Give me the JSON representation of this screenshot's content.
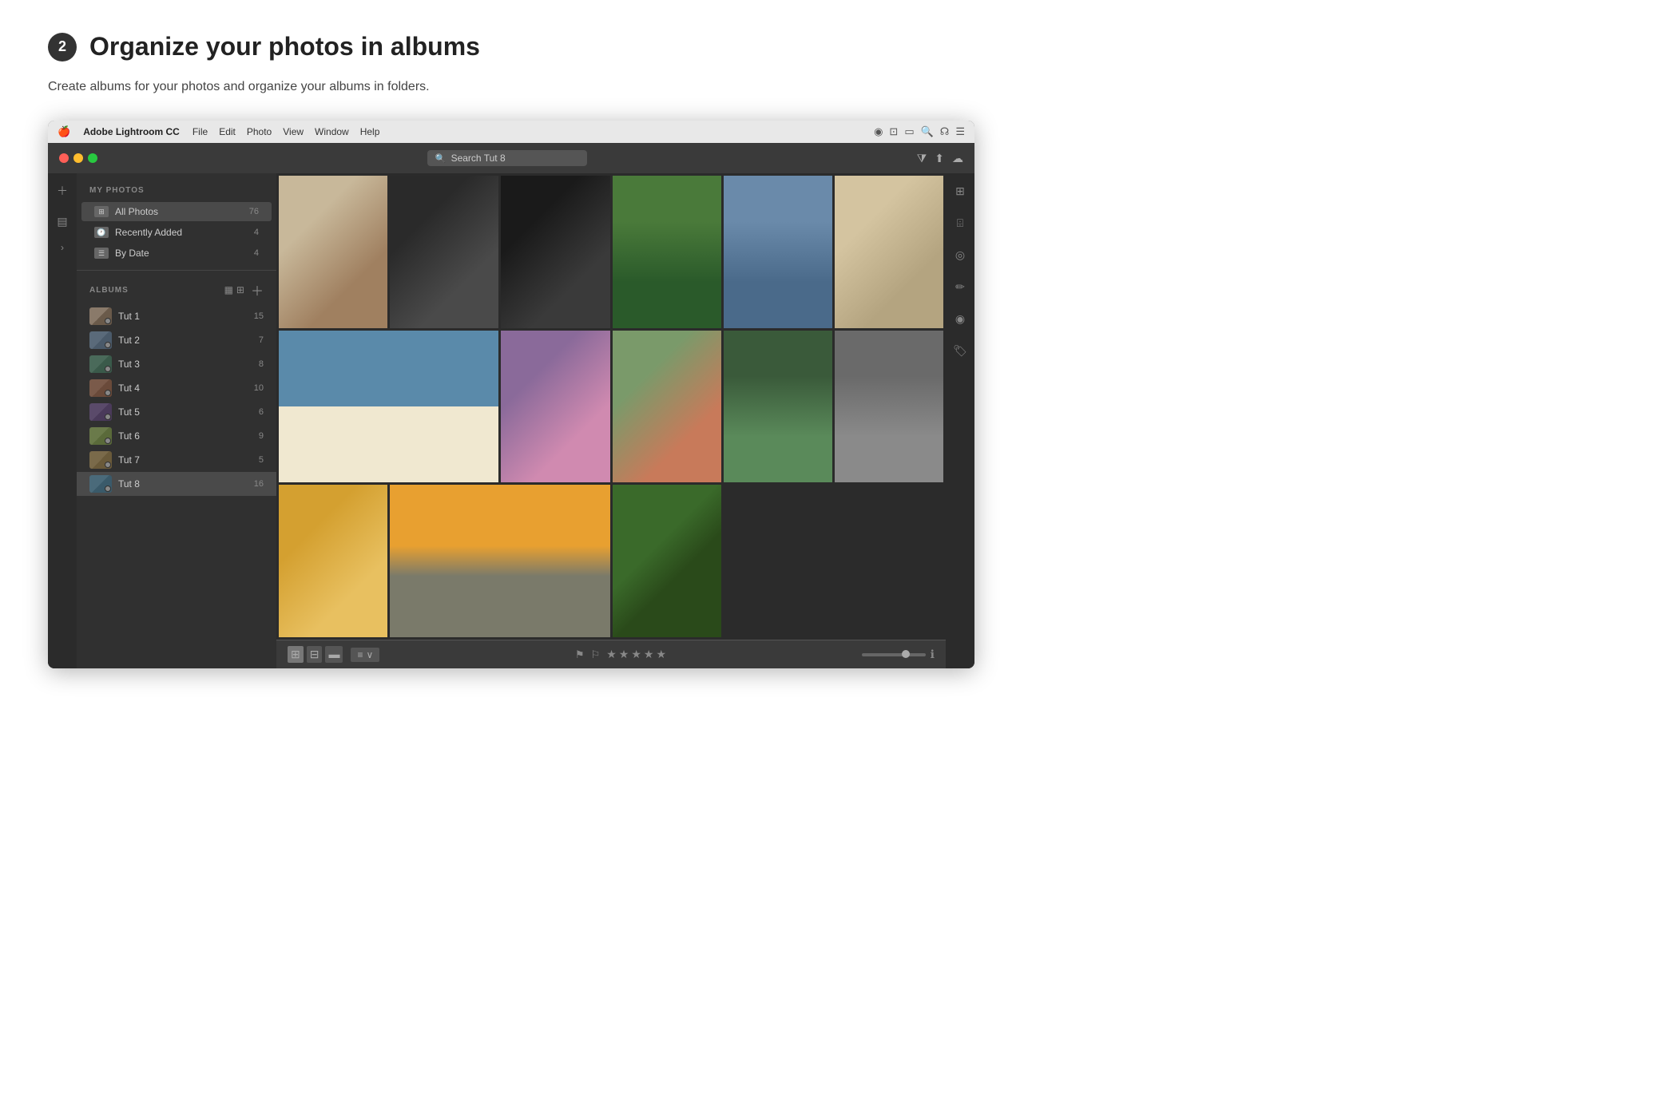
{
  "header": {
    "step_number": "2",
    "title": "Organize your photos in albums",
    "subtitle": "Create albums for your photos and organize your albums in folders."
  },
  "app": {
    "menu_bar": {
      "logo": "🍎",
      "app_name": "Adobe Lightroom CC",
      "menu_items": [
        "File",
        "Edit",
        "Photo",
        "View",
        "Window",
        "Help"
      ]
    },
    "title_bar": {
      "search_placeholder": "Search Tut 8"
    },
    "sidebar": {
      "my_photos_label": "MY PHOTOS",
      "items": [
        {
          "label": "All Photos",
          "count": "76"
        },
        {
          "label": "Recently Added",
          "count": "4"
        },
        {
          "label": "By Date",
          "count": "4"
        }
      ],
      "albums_label": "ALBUMS",
      "albums": [
        {
          "name": "Tut 1",
          "count": "15",
          "thumb_class": "thumb-1"
        },
        {
          "name": "Tut 2",
          "count": "7",
          "thumb_class": "thumb-2"
        },
        {
          "name": "Tut 3",
          "count": "8",
          "thumb_class": "thumb-3"
        },
        {
          "name": "Tut 4",
          "count": "10",
          "thumb_class": "thumb-4"
        },
        {
          "name": "Tut 5",
          "count": "6",
          "thumb_class": "thumb-5"
        },
        {
          "name": "Tut 6",
          "count": "9",
          "thumb_class": "thumb-6"
        },
        {
          "name": "Tut 7",
          "count": "5",
          "thumb_class": "thumb-7"
        },
        {
          "name": "Tut 8",
          "count": "16",
          "thumb_class": "thumb-8"
        }
      ]
    },
    "bottom_bar": {
      "sort_label": "≡ ∨",
      "stars": [
        "★",
        "★",
        "★",
        "★",
        "★"
      ]
    }
  }
}
